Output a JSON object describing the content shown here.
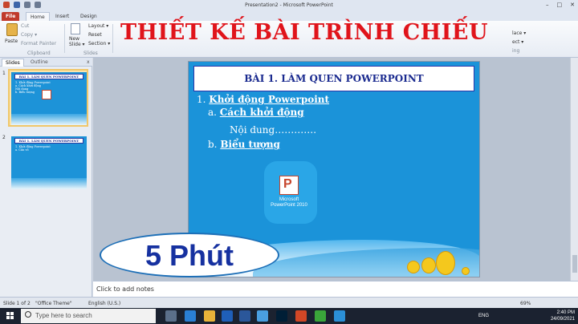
{
  "window": {
    "title": "Presentation2 - Microsoft PowerPoint",
    "min": "–",
    "max": "□",
    "close": "✕"
  },
  "tabs": {
    "file": "File",
    "home": "Home",
    "insert": "Insert",
    "design": "Design"
  },
  "ribbon": {
    "paste": "Paste",
    "cut": "Cut",
    "copy": "Copy ▾",
    "format_painter": "Format Painter",
    "clipboard": "Clipboard",
    "new_slide": "New Slide ▾",
    "layout": "Layout ▾",
    "reset": "Reset",
    "section": "Section ▾",
    "slides": "Slides",
    "right_top": "lace ▾",
    "right_bottom": "ect ▾",
    "right_group": "ing"
  },
  "headline": "THIẾT KẾ BÀI TRÌNH CHIẾU",
  "panel": {
    "slides_tab": "Slides",
    "outline_tab": "Outline",
    "close": "x"
  },
  "thumbs": [
    {
      "num": "1",
      "title": "BÀI 1. LÀM QUEN POWERPOINT",
      "lines": [
        "1. Khởi động Powerpoint",
        "   a. Cách khởi động",
        "      Nội dung",
        "   b. Biểu tượng"
      ]
    },
    {
      "num": "2",
      "title": "BÀI 1. LÀM QUEN POWERPOINT",
      "lines": [
        "1. Khởi động Powerpoint",
        "   a. Cần vô"
      ]
    }
  ],
  "slide": {
    "title": "BÀI 1. LÀM QUEN POWERPOINT",
    "l1_num": "1. ",
    "l1": "Khởi động Powerpoint",
    "l2_num": "a. ",
    "l2": "Cách khởi động",
    "l3": "Nội dung………….",
    "l4_num": "b. ",
    "l4": "Biểu tượng",
    "icon_label": "Microsoft PowerPoint 2010"
  },
  "timer": "5 Phút",
  "notes": "Click to add notes",
  "status": {
    "slide": "Slide 1 of 2",
    "theme": "\"Office Theme\"",
    "lang": "English (U.S.)",
    "zoom": "69%"
  },
  "taskbar": {
    "search": "Type here to search",
    "lang": "ENG",
    "time": "2:40 PM",
    "date": "24/09/2021"
  },
  "colors": {
    "headline": "#e0141b",
    "slide_bg": "#1b93d9",
    "timer_text": "#1631a0"
  }
}
